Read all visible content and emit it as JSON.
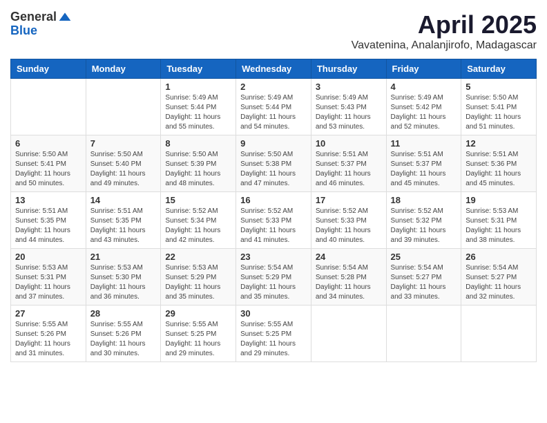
{
  "header": {
    "logo_line1": "General",
    "logo_line2": "Blue",
    "month_title": "April 2025",
    "location": "Vavatenina, Analanjirofo, Madagascar"
  },
  "weekdays": [
    "Sunday",
    "Monday",
    "Tuesday",
    "Wednesday",
    "Thursday",
    "Friday",
    "Saturday"
  ],
  "weeks": [
    [
      {
        "day": "",
        "info": ""
      },
      {
        "day": "",
        "info": ""
      },
      {
        "day": "1",
        "info": "Sunrise: 5:49 AM\nSunset: 5:44 PM\nDaylight: 11 hours and 55 minutes."
      },
      {
        "day": "2",
        "info": "Sunrise: 5:49 AM\nSunset: 5:44 PM\nDaylight: 11 hours and 54 minutes."
      },
      {
        "day": "3",
        "info": "Sunrise: 5:49 AM\nSunset: 5:43 PM\nDaylight: 11 hours and 53 minutes."
      },
      {
        "day": "4",
        "info": "Sunrise: 5:49 AM\nSunset: 5:42 PM\nDaylight: 11 hours and 52 minutes."
      },
      {
        "day": "5",
        "info": "Sunrise: 5:50 AM\nSunset: 5:41 PM\nDaylight: 11 hours and 51 minutes."
      }
    ],
    [
      {
        "day": "6",
        "info": "Sunrise: 5:50 AM\nSunset: 5:41 PM\nDaylight: 11 hours and 50 minutes."
      },
      {
        "day": "7",
        "info": "Sunrise: 5:50 AM\nSunset: 5:40 PM\nDaylight: 11 hours and 49 minutes."
      },
      {
        "day": "8",
        "info": "Sunrise: 5:50 AM\nSunset: 5:39 PM\nDaylight: 11 hours and 48 minutes."
      },
      {
        "day": "9",
        "info": "Sunrise: 5:50 AM\nSunset: 5:38 PM\nDaylight: 11 hours and 47 minutes."
      },
      {
        "day": "10",
        "info": "Sunrise: 5:51 AM\nSunset: 5:37 PM\nDaylight: 11 hours and 46 minutes."
      },
      {
        "day": "11",
        "info": "Sunrise: 5:51 AM\nSunset: 5:37 PM\nDaylight: 11 hours and 45 minutes."
      },
      {
        "day": "12",
        "info": "Sunrise: 5:51 AM\nSunset: 5:36 PM\nDaylight: 11 hours and 45 minutes."
      }
    ],
    [
      {
        "day": "13",
        "info": "Sunrise: 5:51 AM\nSunset: 5:35 PM\nDaylight: 11 hours and 44 minutes."
      },
      {
        "day": "14",
        "info": "Sunrise: 5:51 AM\nSunset: 5:35 PM\nDaylight: 11 hours and 43 minutes."
      },
      {
        "day": "15",
        "info": "Sunrise: 5:52 AM\nSunset: 5:34 PM\nDaylight: 11 hours and 42 minutes."
      },
      {
        "day": "16",
        "info": "Sunrise: 5:52 AM\nSunset: 5:33 PM\nDaylight: 11 hours and 41 minutes."
      },
      {
        "day": "17",
        "info": "Sunrise: 5:52 AM\nSunset: 5:33 PM\nDaylight: 11 hours and 40 minutes."
      },
      {
        "day": "18",
        "info": "Sunrise: 5:52 AM\nSunset: 5:32 PM\nDaylight: 11 hours and 39 minutes."
      },
      {
        "day": "19",
        "info": "Sunrise: 5:53 AM\nSunset: 5:31 PM\nDaylight: 11 hours and 38 minutes."
      }
    ],
    [
      {
        "day": "20",
        "info": "Sunrise: 5:53 AM\nSunset: 5:31 PM\nDaylight: 11 hours and 37 minutes."
      },
      {
        "day": "21",
        "info": "Sunrise: 5:53 AM\nSunset: 5:30 PM\nDaylight: 11 hours and 36 minutes."
      },
      {
        "day": "22",
        "info": "Sunrise: 5:53 AM\nSunset: 5:29 PM\nDaylight: 11 hours and 35 minutes."
      },
      {
        "day": "23",
        "info": "Sunrise: 5:54 AM\nSunset: 5:29 PM\nDaylight: 11 hours and 35 minutes."
      },
      {
        "day": "24",
        "info": "Sunrise: 5:54 AM\nSunset: 5:28 PM\nDaylight: 11 hours and 34 minutes."
      },
      {
        "day": "25",
        "info": "Sunrise: 5:54 AM\nSunset: 5:27 PM\nDaylight: 11 hours and 33 minutes."
      },
      {
        "day": "26",
        "info": "Sunrise: 5:54 AM\nSunset: 5:27 PM\nDaylight: 11 hours and 32 minutes."
      }
    ],
    [
      {
        "day": "27",
        "info": "Sunrise: 5:55 AM\nSunset: 5:26 PM\nDaylight: 11 hours and 31 minutes."
      },
      {
        "day": "28",
        "info": "Sunrise: 5:55 AM\nSunset: 5:26 PM\nDaylight: 11 hours and 30 minutes."
      },
      {
        "day": "29",
        "info": "Sunrise: 5:55 AM\nSunset: 5:25 PM\nDaylight: 11 hours and 29 minutes."
      },
      {
        "day": "30",
        "info": "Sunrise: 5:55 AM\nSunset: 5:25 PM\nDaylight: 11 hours and 29 minutes."
      },
      {
        "day": "",
        "info": ""
      },
      {
        "day": "",
        "info": ""
      },
      {
        "day": "",
        "info": ""
      }
    ]
  ]
}
